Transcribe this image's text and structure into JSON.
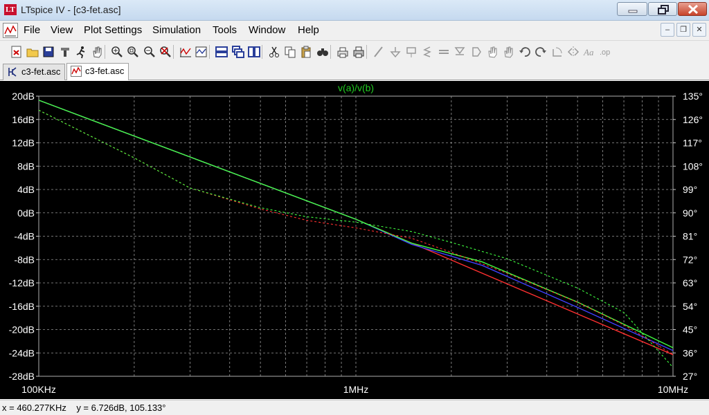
{
  "window": {
    "title": "LTspice IV - [c3-fet.asc]",
    "logo_text": "LT"
  },
  "menu": [
    {
      "label": "File"
    },
    {
      "label": "View"
    },
    {
      "label": "Plot Settings"
    },
    {
      "label": "Simulation"
    },
    {
      "label": "Tools"
    },
    {
      "label": "Window"
    },
    {
      "label": "Help"
    }
  ],
  "toolbar_icons": [
    "new-schematic-icon",
    "open-folder-icon",
    "save-icon",
    "control-panel-icon",
    "run-icon",
    "pan-hand-icon",
    "zoom-in-icon",
    "zoom-area-icon",
    "zoom-out-icon",
    "zoom-fit-icon",
    "autorange-icon",
    "plot-settings-icon",
    "tile-horizontal-icon",
    "cascade-icon",
    "tile-vertical-icon",
    "cut-icon",
    "copy-icon",
    "paste-icon",
    "find-icon",
    "print-setup-icon",
    "print-icon",
    "wire-icon",
    "ground-icon",
    "resistor-icon",
    "inductor-icon",
    "capacitor-icon",
    "diode-icon",
    "component-icon",
    "move-icon",
    "drag-icon",
    "undo-icon",
    "redo-icon",
    "rotate-icon",
    "mirror-icon",
    "text-icon",
    "spice-directive-icon"
  ],
  "tabs": [
    {
      "label": "c3-fet.asc",
      "icon": "schematic-icon",
      "active": false
    },
    {
      "label": "c3-fet.asc",
      "icon": "waveform-icon",
      "active": true
    }
  ],
  "status": {
    "text": "x = 460.277KHz    y = 6.726dB, 105.133°"
  },
  "colors": {
    "plot_background": "#000000",
    "grid": "#9a9a9a",
    "trace_title": "#22cc22"
  },
  "chart_data": {
    "type": "line",
    "title": "v(a)/v(b)",
    "x_scale": "log",
    "xlim": [
      100000,
      10000000
    ],
    "x_ticks": [
      "100KHz",
      "1MHz",
      "10MHz"
    ],
    "ylim_left": [
      -28,
      20
    ],
    "ylim_right": [
      27,
      135
    ],
    "y_ticks_left": [
      "20dB",
      "16dB",
      "12dB",
      "8dB",
      "4dB",
      "0dB",
      "-4dB",
      "-8dB",
      "-12dB",
      "-16dB",
      "-20dB",
      "-24dB",
      "-28dB"
    ],
    "y_ticks_right": [
      "135°",
      "126°",
      "117°",
      "108°",
      "99°",
      "90°",
      "81°",
      "72°",
      "63°",
      "54°",
      "45°",
      "36°",
      "27°"
    ],
    "grid": true,
    "series": [
      {
        "axis": "left",
        "color": "#ff3030",
        "dashed": false,
        "x": [
          100000,
          1000000,
          10000000
        ],
        "y": [
          19.3,
          -1.1,
          -24.3
        ]
      },
      {
        "axis": "left",
        "color": "#4040ff",
        "dashed": false,
        "x": [
          100000,
          1000000,
          1500000,
          2500000,
          5000000,
          10000000
        ],
        "y": [
          19.3,
          -1.1,
          -5.4,
          -9.0,
          -16.2,
          -23.6
        ]
      },
      {
        "axis": "left",
        "color": "#40ff40",
        "dashed": false,
        "x": [
          100000,
          1000000,
          1500000,
          2500000,
          5000000,
          10000000
        ],
        "y": [
          19.3,
          -1.1,
          -5.2,
          -8.4,
          -15.3,
          -23.1
        ]
      },
      {
        "axis": "right",
        "color": "#ff3030",
        "dashed": true,
        "x": [
          100000,
          200000,
          300000,
          500000,
          700000,
          1000000,
          1500000,
          2000000,
          3000000,
          5000000,
          7000000,
          10000000
        ],
        "y": [
          129.6,
          111.2,
          99.6,
          91.5,
          87.1,
          84.2,
          80.2,
          74.8,
          66.7,
          55.5,
          46.8,
          35.4
        ]
      },
      {
        "axis": "right",
        "color": "#40ff40",
        "dashed": true,
        "x": [
          100000,
          200000,
          300000,
          500000,
          700000,
          1000000,
          1500000,
          2000000,
          3000000,
          5000000,
          7000000,
          10000000
        ],
        "y": [
          129.6,
          111.2,
          99.6,
          92.0,
          88.5,
          86.4,
          82.8,
          78.6,
          72.3,
          61.0,
          51.6,
          30.4
        ]
      }
    ]
  }
}
